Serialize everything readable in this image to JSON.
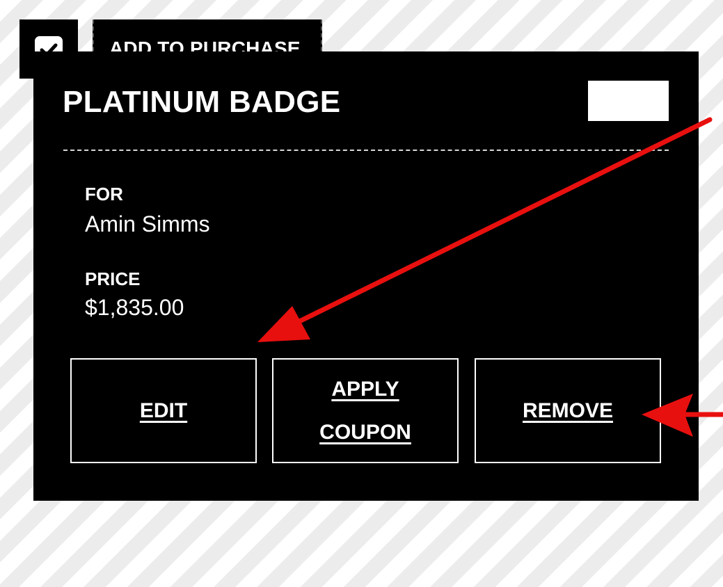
{
  "tab": {
    "checked": true,
    "label": "ADD TO PURCHASE"
  },
  "item": {
    "title": "PLATINUM BADGE",
    "for_label": "FOR",
    "for_value": "Amin Simms",
    "price_label": "PRICE",
    "price_value": "$1,835.00"
  },
  "actions": {
    "edit": "EDIT",
    "apply_line1": "APPLY",
    "apply_line2": "COUPON",
    "remove": "REMOVE"
  },
  "annotations": {
    "arrow_color": "#e8100f",
    "card_color": "#000000"
  }
}
